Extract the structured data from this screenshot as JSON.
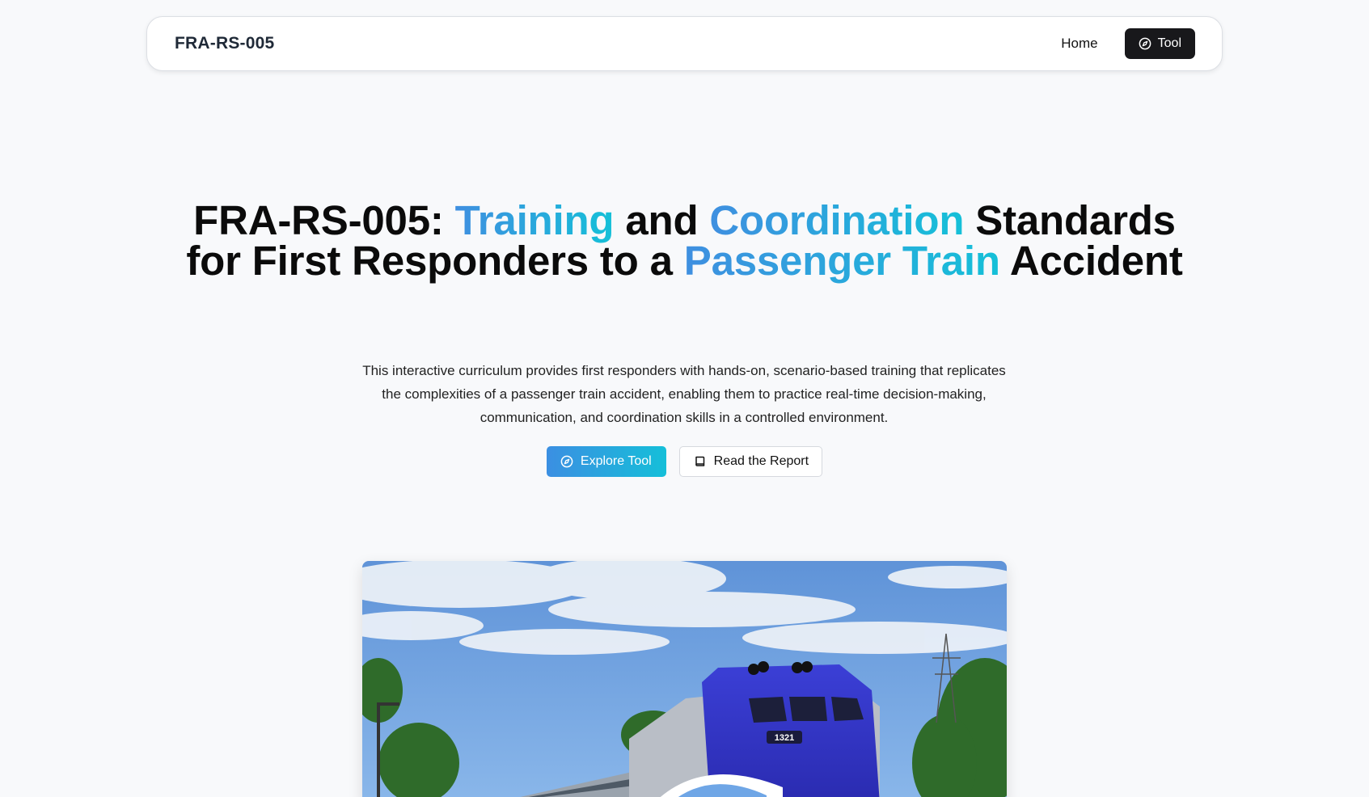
{
  "navbar": {
    "brand": "FRA-RS-005",
    "home_label": "Home",
    "tool_label": "Tool",
    "tool_icon": "compass-icon"
  },
  "hero": {
    "title_parts": [
      {
        "text": "FRA-RS-005: ",
        "accent": false
      },
      {
        "text": "Training",
        "accent": true
      },
      {
        "text": " and ",
        "accent": false
      },
      {
        "text": "Coordination",
        "accent": true
      },
      {
        "text": " Standards for First Responders to a ",
        "accent": false
      },
      {
        "text": "Passenger Train",
        "accent": true
      },
      {
        "text": " Accident",
        "accent": false
      }
    ],
    "description": "This interactive curriculum provides first responders with hands-on, scenario-based training that replicates the complexities of a passenger train accident, enabling them to practice real-time decision-making, communication, and coordination skills in a controlled environment.",
    "primary_button": {
      "label": "Explore Tool",
      "icon": "compass-icon"
    },
    "secondary_button": {
      "label": "Read the Report",
      "icon": "book-icon"
    },
    "image": {
      "unit_number": "1321"
    }
  },
  "colors": {
    "accent_start": "#3f8fe0",
    "accent_end": "#15c0d8",
    "tool_button_bg": "#18181b",
    "page_bg": "#f8f9fb"
  }
}
